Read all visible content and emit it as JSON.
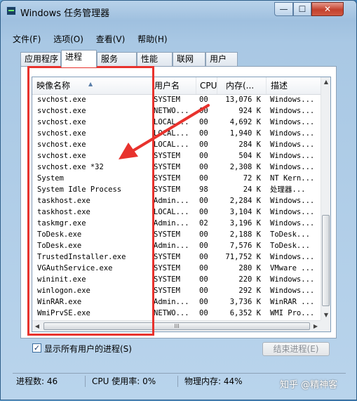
{
  "window": {
    "title": "Windows 任务管理器",
    "minimize_label": "—",
    "maximize_label": "☐",
    "close_label": "✕"
  },
  "menu": [
    "文件(F)",
    "选项(O)",
    "查看(V)",
    "帮助(H)"
  ],
  "tabs": [
    {
      "label": "应用程序",
      "active": false
    },
    {
      "label": "进程",
      "active": true
    },
    {
      "label": "服务",
      "active": false
    },
    {
      "label": "性能",
      "active": false
    },
    {
      "label": "联网",
      "active": false
    },
    {
      "label": "用户",
      "active": false
    }
  ],
  "columns": {
    "name": "映像名称",
    "user": "用户名",
    "cpu": "CPU",
    "mem": "内存(...",
    "desc": "描述"
  },
  "processes": [
    {
      "name": "svchost.exe",
      "user": "SYSTEM",
      "cpu": "00",
      "mem": "13,076 K",
      "desc": "Windows..."
    },
    {
      "name": "svchost.exe",
      "user": "NETWO...",
      "cpu": "00",
      "mem": "924 K",
      "desc": "Windows..."
    },
    {
      "name": "svchost.exe",
      "user": "LOCAL...",
      "cpu": "00",
      "mem": "4,692 K",
      "desc": "Windows..."
    },
    {
      "name": "svchost.exe",
      "user": "LOCAL...",
      "cpu": "00",
      "mem": "1,940 K",
      "desc": "Windows..."
    },
    {
      "name": "svchost.exe",
      "user": "LOCAL...",
      "cpu": "00",
      "mem": "284 K",
      "desc": "Windows..."
    },
    {
      "name": "svchost.exe",
      "user": "SYSTEM",
      "cpu": "00",
      "mem": "504 K",
      "desc": "Windows..."
    },
    {
      "name": "svchost.exe *32",
      "user": "SYSTEM",
      "cpu": "00",
      "mem": "2,308 K",
      "desc": "Windows..."
    },
    {
      "name": "System",
      "user": "SYSTEM",
      "cpu": "00",
      "mem": "72 K",
      "desc": "NT Kern..."
    },
    {
      "name": "System Idle Process",
      "user": "SYSTEM",
      "cpu": "98",
      "mem": "24 K",
      "desc": "处理器..."
    },
    {
      "name": "taskhost.exe",
      "user": "Admin...",
      "cpu": "00",
      "mem": "2,284 K",
      "desc": "Windows..."
    },
    {
      "name": "taskhost.exe",
      "user": "LOCAL...",
      "cpu": "00",
      "mem": "3,104 K",
      "desc": "Windows..."
    },
    {
      "name": "taskmgr.exe",
      "user": "Admin...",
      "cpu": "02",
      "mem": "3,196 K",
      "desc": "Windows..."
    },
    {
      "name": "ToDesk.exe",
      "user": "SYSTEM",
      "cpu": "00",
      "mem": "2,188 K",
      "desc": "ToDesk..."
    },
    {
      "name": "ToDesk.exe",
      "user": "Admin...",
      "cpu": "00",
      "mem": "7,576 K",
      "desc": "ToDesk..."
    },
    {
      "name": "TrustedInstaller.exe",
      "user": "SYSTEM",
      "cpu": "00",
      "mem": "71,752 K",
      "desc": "Windows..."
    },
    {
      "name": "VGAuthService.exe",
      "user": "SYSTEM",
      "cpu": "00",
      "mem": "280 K",
      "desc": "VMware ..."
    },
    {
      "name": "wininit.exe",
      "user": "SYSTEM",
      "cpu": "00",
      "mem": "220 K",
      "desc": "Windows..."
    },
    {
      "name": "winlogon.exe",
      "user": "SYSTEM",
      "cpu": "00",
      "mem": "292 K",
      "desc": "Windows..."
    },
    {
      "name": "WinRAR.exe",
      "user": "Admin...",
      "cpu": "00",
      "mem": "3,736 K",
      "desc": "WinRAR ..."
    },
    {
      "name": "WmiPrvSE.exe",
      "user": "NETWO...",
      "cpu": "00",
      "mem": "6,352 K",
      "desc": "WMI Pro..."
    }
  ],
  "show_all_users": {
    "label": "显示所有用户的进程(S)",
    "checked": true,
    "check_glyph": "✓"
  },
  "end_process_label": "结束进程(E)",
  "status": {
    "processes": "进程数: 46",
    "cpu": "CPU 使用率: 0%",
    "memory": "物理内存: 44%"
  },
  "watermark": "知乎 @精神客",
  "annotation_color": "#e8322d",
  "scroll_glyphs": {
    "up": "▲",
    "down": "▼",
    "left": "◀",
    "right": "▶",
    "grip": "III"
  }
}
